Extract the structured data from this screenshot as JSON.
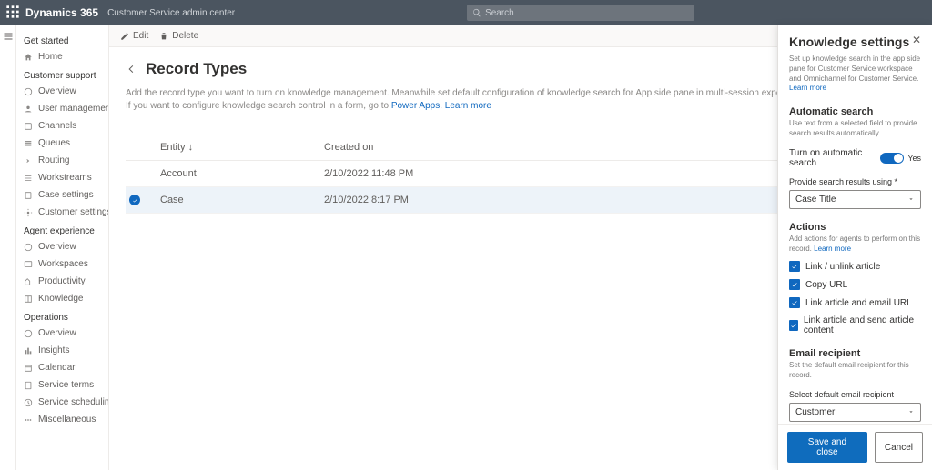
{
  "header": {
    "brand": "Dynamics 365",
    "app_name": "Customer Service admin center",
    "search_placeholder": "Search"
  },
  "sidebar": {
    "groups": [
      {
        "name": "Get started",
        "items": [
          {
            "label": "Home"
          }
        ]
      },
      {
        "name": "Customer support",
        "items": [
          {
            "label": "Overview"
          },
          {
            "label": "User management"
          },
          {
            "label": "Channels"
          },
          {
            "label": "Queues"
          },
          {
            "label": "Routing"
          },
          {
            "label": "Workstreams"
          },
          {
            "label": "Case settings"
          },
          {
            "label": "Customer settings"
          }
        ]
      },
      {
        "name": "Agent experience",
        "items": [
          {
            "label": "Overview"
          },
          {
            "label": "Workspaces"
          },
          {
            "label": "Productivity"
          },
          {
            "label": "Knowledge"
          }
        ]
      },
      {
        "name": "Operations",
        "items": [
          {
            "label": "Overview"
          },
          {
            "label": "Insights"
          },
          {
            "label": "Calendar"
          },
          {
            "label": "Service terms"
          },
          {
            "label": "Service scheduling"
          },
          {
            "label": "Miscellaneous"
          }
        ]
      }
    ]
  },
  "commandbar": {
    "edit": "Edit",
    "delete": "Delete"
  },
  "page": {
    "title": "Record Types",
    "desc_line1": "Add the record type you want to turn on knowledge management. Meanwhile set default configuration of knowledge search for App side pane in multi-session experience. ",
    "desc_link1": "Learn more",
    "desc_line2": "If you want to configure knowledge search control in a form, go to ",
    "desc_link2a": "Power Apps",
    "desc_link2b": "Learn more"
  },
  "table": {
    "col_entity": "Entity",
    "col_created": "Created on",
    "sort_indicator": "↓",
    "rows": [
      {
        "entity": "Account",
        "created": "2/10/2022 11:48 PM",
        "selected": false
      },
      {
        "entity": "Case",
        "created": "2/10/2022 8:17 PM",
        "selected": true
      }
    ]
  },
  "panel": {
    "title": "Knowledge settings",
    "subtitle_prefix": "Set up knowledge search in the app side pane for Customer Service workspace and Omnichannel for Customer Service. ",
    "subtitle_link": "Learn more",
    "automatic_search": {
      "heading": "Automatic search",
      "desc": "Use text from a selected field to provide search results automatically.",
      "toggle_label": "Turn on automatic search",
      "toggle_state": "Yes",
      "field_label": "Provide search results using *",
      "field_value": "Case Title"
    },
    "actions": {
      "heading": "Actions",
      "desc_prefix": "Add actions for agents to perform on this record. ",
      "desc_link": "Learn more",
      "items": [
        "Link / unlink article",
        "Copy URL",
        "Link article and email URL",
        "Link article and send article content"
      ]
    },
    "email": {
      "heading": "Email recipient",
      "desc": "Set the default email recipient for this record.",
      "field_label": "Select default email recipient",
      "field_value": "Customer"
    },
    "footer": {
      "primary": "Save and close",
      "secondary": "Cancel"
    }
  }
}
